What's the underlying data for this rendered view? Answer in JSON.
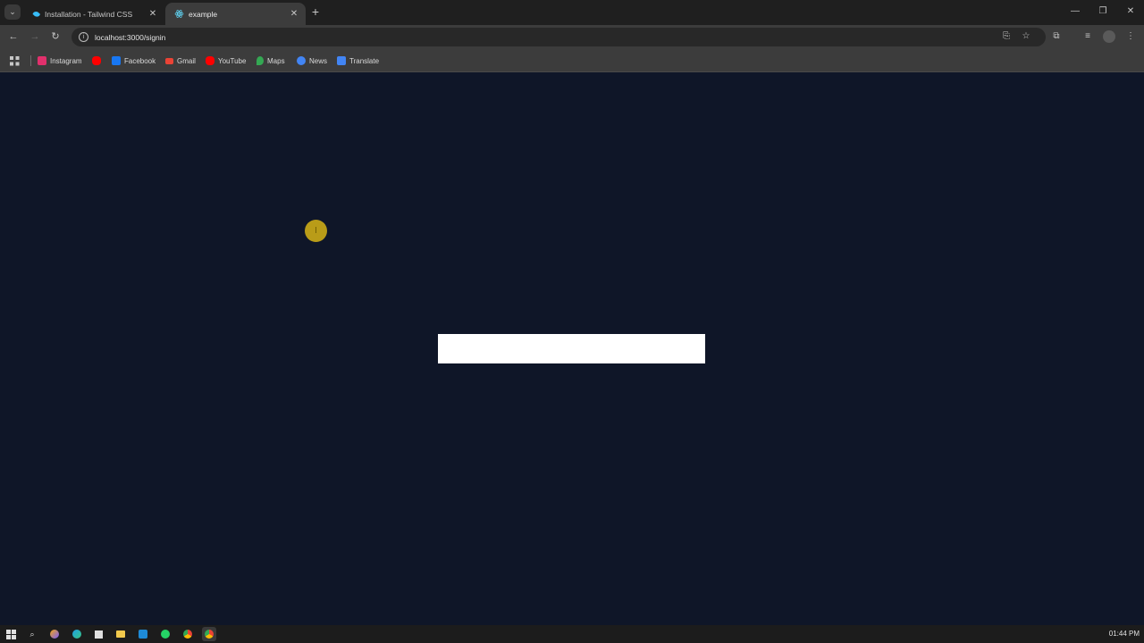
{
  "browser": {
    "tabs": [
      {
        "label": "Installation - Tailwind CSS",
        "active": false,
        "icon": "tailwind-icon"
      },
      {
        "label": "example",
        "active": true,
        "icon": "react-icon"
      }
    ],
    "address": "localhost:3000/signin",
    "bookmarks": [
      {
        "label": "Instagram",
        "icon": "instagram-icon",
        "color": "#e1306c"
      },
      {
        "label": "",
        "icon": "youtube-icon",
        "color": "#ff0000"
      },
      {
        "label": "Facebook",
        "icon": "facebook-icon",
        "color": "#1877f2"
      },
      {
        "label": "Gmail",
        "icon": "gmail-icon",
        "color": "#ea4335"
      },
      {
        "label": "YouTube",
        "icon": "youtube-icon",
        "color": "#ff0000"
      },
      {
        "label": "Maps",
        "icon": "maps-icon",
        "color": "#34a853"
      },
      {
        "label": "News",
        "icon": "news-icon",
        "color": "#4285f4"
      },
      {
        "label": "Translate",
        "icon": "translate-icon",
        "color": "#4285f4"
      }
    ]
  },
  "page": {
    "background": "#0f1628",
    "box_color": "#ffffff"
  },
  "taskbar": {
    "clock": "01:44 PM"
  }
}
